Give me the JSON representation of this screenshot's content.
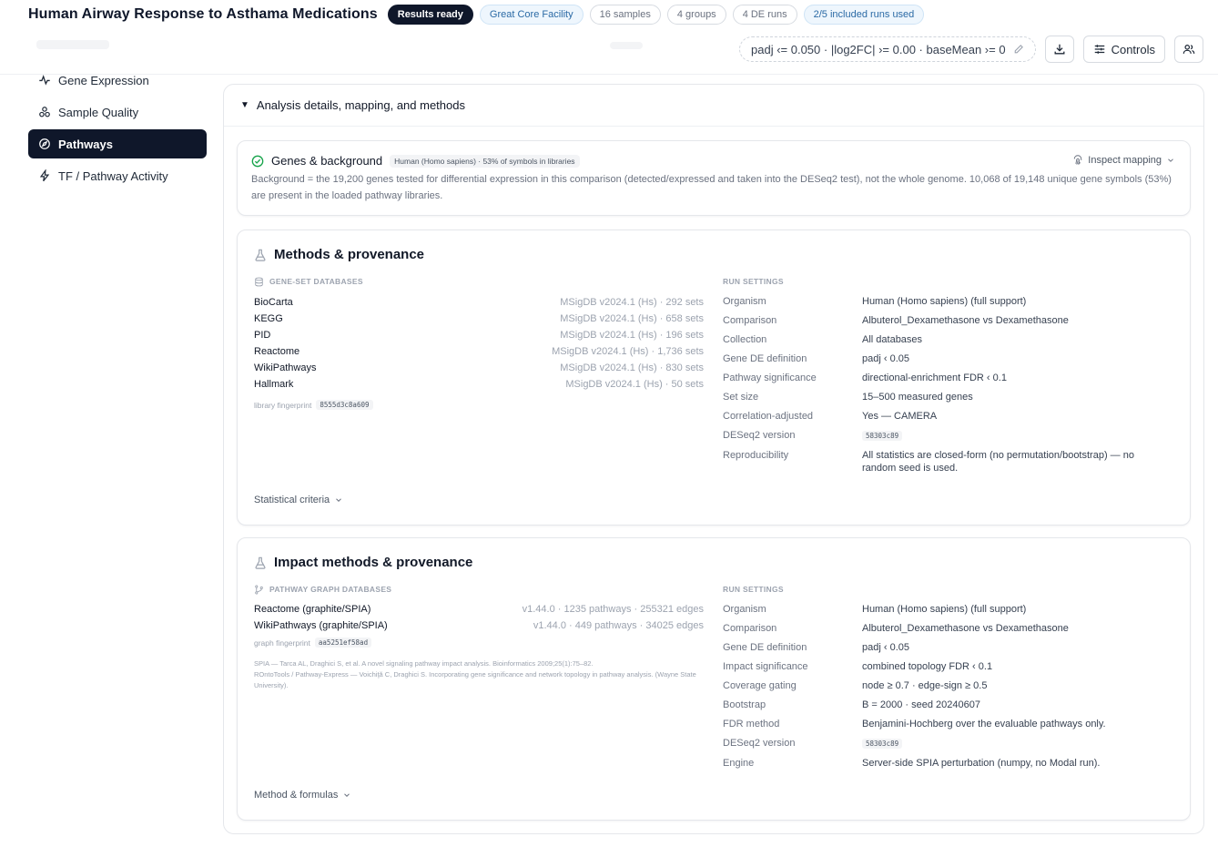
{
  "header": {
    "title": "Human Airway Response to Asthama Medications",
    "chips": {
      "status": "Results ready",
      "facility": "Great Core Facility",
      "samples": "16 samples",
      "groups": "4 groups",
      "de_runs": "4 DE runs",
      "runs_used": "2/5 included runs used"
    },
    "filter_summary": "padj ‹= 0.050 · |log2FC| ›= 0.00 · baseMean ›= 0",
    "controls_label": "Controls"
  },
  "sidebar": {
    "items": [
      {
        "label": "Gene Expression",
        "icon": "activity-icon"
      },
      {
        "label": "Sample Quality",
        "icon": "cluster-icon"
      },
      {
        "label": "Pathways",
        "icon": "compass-icon",
        "active": true
      },
      {
        "label": "TF / Pathway Activity",
        "icon": "bolt-icon"
      }
    ]
  },
  "details": {
    "toggle_label": "Analysis details, mapping, and methods"
  },
  "genes_card": {
    "title": "Genes & background",
    "badge": "Human (Homo sapiens) · 53% of symbols in libraries",
    "inspect_label": "Inspect mapping",
    "text": "Background = the 19,200 genes tested for differential expression in this comparison (detected/expressed and taken into the DESeq2 test), not the whole genome. 10,068 of 19,148 unique gene symbols (53%) are present in the loaded pathway libraries."
  },
  "methods_card": {
    "title": "Methods & provenance",
    "db_label": "GENE-SET DATABASES",
    "databases": [
      {
        "name": "BioCarta",
        "meta": "MSigDB v2024.1 (Hs) · 292 sets"
      },
      {
        "name": "KEGG",
        "meta": "MSigDB v2024.1 (Hs) · 658 sets"
      },
      {
        "name": "PID",
        "meta": "MSigDB v2024.1 (Hs) · 196 sets"
      },
      {
        "name": "Reactome",
        "meta": "MSigDB v2024.1 (Hs) · 1,736 sets"
      },
      {
        "name": "WikiPathways",
        "meta": "MSigDB v2024.1 (Hs) · 830 sets"
      },
      {
        "name": "Hallmark",
        "meta": "MSigDB v2024.1 (Hs) · 50 sets"
      }
    ],
    "fingerprint_label": "library fingerprint",
    "fingerprint": "8555d3c8a609",
    "run_label": "RUN SETTINGS",
    "settings": [
      {
        "key": "Organism",
        "value": "Human (Homo sapiens) (full support)"
      },
      {
        "key": "Comparison",
        "value": "Albuterol_Dexamethasone vs Dexamethasone"
      },
      {
        "key": "Collection",
        "value": "All databases"
      },
      {
        "key": "Gene DE definition",
        "value": "padj ‹ 0.05"
      },
      {
        "key": "Pathway significance",
        "value": "directional-enrichment FDR ‹ 0.1"
      },
      {
        "key": "Set size",
        "value": "15–500 measured genes"
      },
      {
        "key": "Correlation-adjusted",
        "value": "Yes — CAMERA"
      },
      {
        "key": "DESeq2 version",
        "value": "58303c89"
      },
      {
        "key": "Reproducibility",
        "value": "All statistics are closed-form (no permutation/bootstrap) — no random seed is used."
      }
    ],
    "footer_label": "Statistical criteria"
  },
  "impact_card": {
    "title": "Impact methods & provenance",
    "db_label": "PATHWAY GRAPH DATABASES",
    "databases": [
      {
        "name": "Reactome (graphite/SPIA)",
        "meta": "v1.44.0 · 1235 pathways · 255321 edges"
      },
      {
        "name": "WikiPathways (graphite/SPIA)",
        "meta": "v1.44.0 · 449 pathways · 34025 edges"
      }
    ],
    "fingerprint_label": "graph fingerprint",
    "fingerprint": "aa5251ef58ad",
    "references": [
      "SPIA — Tarca AL, Draghici S, et al. A novel signaling pathway impact analysis. Bioinformatics 2009;25(1):75–82.",
      "ROntoTools / Pathway-Express — Voichiţă C, Draghici S. Incorporating gene significance and network topology in pathway analysis. (Wayne State University)."
    ],
    "run_label": "RUN SETTINGS",
    "settings": [
      {
        "key": "Organism",
        "value": "Human (Homo sapiens) (full support)"
      },
      {
        "key": "Comparison",
        "value": "Albuterol_Dexamethasone vs Dexamethasone"
      },
      {
        "key": "Gene DE definition",
        "value": "padj ‹ 0.05"
      },
      {
        "key": "Impact significance",
        "value": "combined topology FDR ‹ 0.1"
      },
      {
        "key": "Coverage gating",
        "value": "node ≥ 0.7 · edge-sign ≥ 0.5"
      },
      {
        "key": "Bootstrap",
        "value": "B = 2000 · seed 20240607"
      },
      {
        "key": "FDR method",
        "value": "Benjamini-Hochberg over the evaluable pathways only."
      },
      {
        "key": "DESeq2 version",
        "value": "58303c89"
      },
      {
        "key": "Engine",
        "value": "Server-side SPIA perturbation (numpy, no Modal run)."
      }
    ],
    "footer_label": "Method & formulas"
  }
}
